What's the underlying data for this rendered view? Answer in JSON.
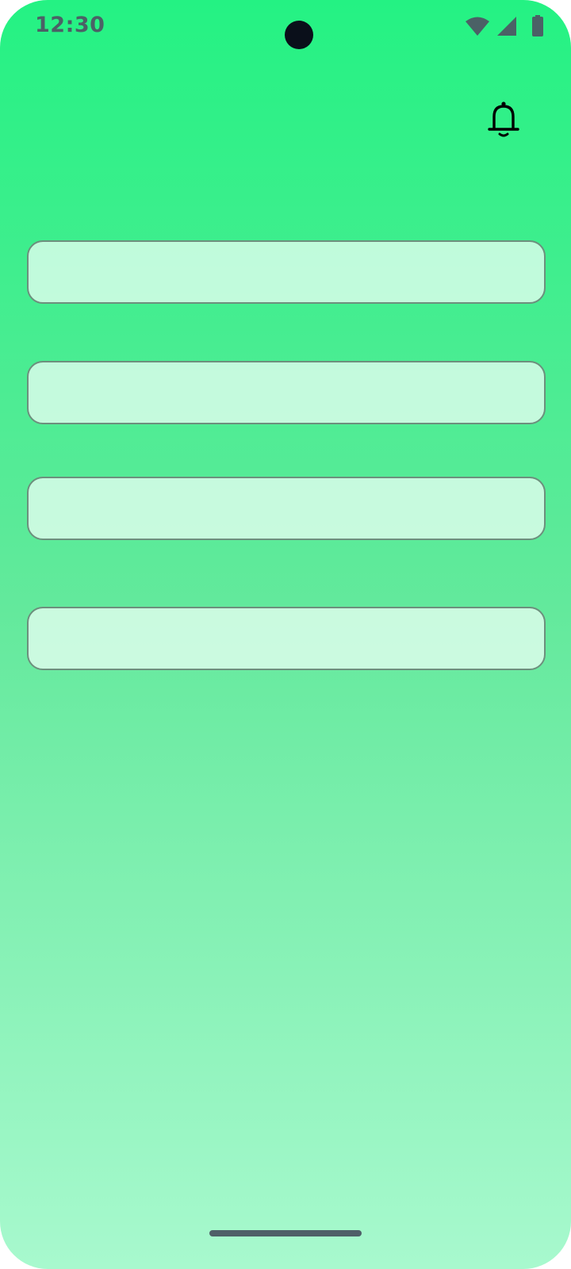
{
  "status_bar": {
    "time": "12:30",
    "icons": [
      "wifi-icon",
      "cellular-signal-icon",
      "battery-icon"
    ]
  },
  "header": {
    "notification_icon": "bell-icon"
  },
  "form": {
    "fields": [
      {
        "value": "",
        "placeholder": ""
      },
      {
        "value": "",
        "placeholder": ""
      },
      {
        "value": "",
        "placeholder": ""
      },
      {
        "value": "",
        "placeholder": ""
      }
    ]
  },
  "colors": {
    "gradient_top": "#24f283",
    "gradient_bottom": "#a8f9ce",
    "field_fill": "#d4f9e5",
    "field_border": "#6d8f7d",
    "status_icon": "#4b6166"
  }
}
